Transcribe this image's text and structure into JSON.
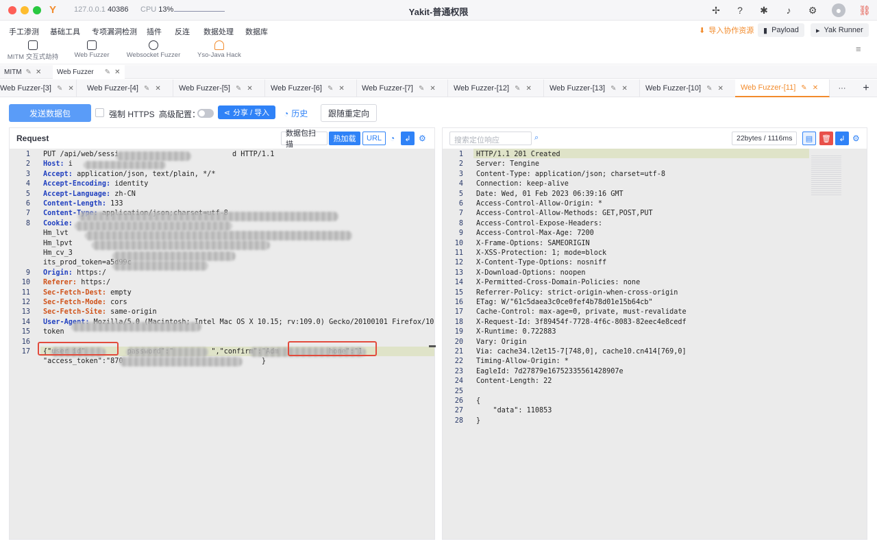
{
  "titlebar": {
    "engine_host": "127.0.0.1",
    "engine_port": "40386",
    "cpu_label": "CPU",
    "cpu_value": "13%",
    "title": "Yakit-普通权限"
  },
  "menu": {
    "items": [
      "手工渗测",
      "基础工具",
      "专项漏洞检测",
      "插件",
      "反连",
      "数据处理",
      "数据库"
    ],
    "quick": [
      "MITM 交互式劫持",
      "Web Fuzzer",
      "Websocket Fuzzer",
      "Yso-Java Hack"
    ],
    "import_label": "导入协作资源",
    "payload_label": "Payload",
    "runner_label": "Yak Runner"
  },
  "page_tabs": [
    {
      "label": "MITM"
    },
    {
      "label": "Web Fuzzer"
    }
  ],
  "fuzzer_tabs": [
    "Web Fuzzer-[3]",
    "Web Fuzzer-[4]",
    "Web Fuzzer-[5]",
    "Web Fuzzer-[6]",
    "Web Fuzzer-[7]",
    "Web Fuzzer-[12]",
    "Web Fuzzer-[13]",
    "Web Fuzzer-[10]",
    "Web Fuzzer-[11]"
  ],
  "fuzzer_more": "···",
  "toolbar": {
    "send": "发送数据包",
    "force_https": "强制 HTTPS",
    "advanced": "高级配置：",
    "share": "分享 / 导入",
    "history": "历史",
    "redirect": "跟随重定向"
  },
  "request": {
    "title": "Request",
    "btn_scan": "数据包扫描",
    "btn_hot": "热加载",
    "btn_url": "URL",
    "lines": [
      {
        "n": "1",
        "key": "",
        "val": "PUT /api/web/sessi                           d HTTP/1.1"
      },
      {
        "n": "2",
        "key": "Host:",
        "val": " i"
      },
      {
        "n": "3",
        "key": "Accept:",
        "val": " application/json, text/plain, */*"
      },
      {
        "n": "4",
        "key": "Accept-Encoding:",
        "val": " identity"
      },
      {
        "n": "5",
        "key": "Accept-Language:",
        "val": " zh-CN"
      },
      {
        "n": "6",
        "key": "Content-Length:",
        "val": " 133"
      },
      {
        "n": "7",
        "key": "Content-Type:",
        "val": " application/json;charset=utf-8"
      },
      {
        "n": "8",
        "key": "Cookie:",
        "val": ""
      },
      {
        "n": "",
        "key": "",
        "val": "Hm_lvt"
      },
      {
        "n": "",
        "key": "",
        "val": "Hm_lpvt"
      },
      {
        "n": "",
        "key": "",
        "val": "Hm_cv_3"
      },
      {
        "n": "",
        "key": "",
        "val": "its_prod_token=a5d99c"
      },
      {
        "n": "9",
        "key": "Origin:",
        "val": " https:/"
      },
      {
        "n": "10",
        "key": "Referer:",
        "val": " https:/"
      },
      {
        "n": "11",
        "key": "Sec-Fetch-Dest:",
        "val": " empty"
      },
      {
        "n": "12",
        "key": "Sec-Fetch-Mode:",
        "val": " cors"
      },
      {
        "n": "13",
        "key": "Sec-Fetch-Site:",
        "val": " same-origin"
      },
      {
        "n": "14",
        "key": "User-Agent:",
        "val": " Mozilla/5.0 (Macintosh; Intel Mac OS X 10.15; rv:109.0) Gecko/20100101 Firefox/109.0"
      },
      {
        "n": "15",
        "key": "",
        "val": "token"
      },
      {
        "n": "16",
        "key": "",
        "val": ""
      },
      {
        "n": "17",
        "key": "",
        "val": "{\"user_id\"          password\":\"         \",\"confirm\":\"Adm            hone\":\"1"
      },
      {
        "n": "",
        "key": "",
        "val": "\"access_token\":\"870                                 }"
      }
    ]
  },
  "response": {
    "search_placeholder": "搜索定位响应",
    "bytes": "22bytes / 1116ms",
    "lines": [
      {
        "n": "1",
        "val": "HTTP/1.1 201 Created"
      },
      {
        "n": "2",
        "val": "Server: Tengine"
      },
      {
        "n": "3",
        "val": "Content-Type: application/json; charset=utf-8"
      },
      {
        "n": "4",
        "val": "Connection: keep-alive"
      },
      {
        "n": "5",
        "val": "Date: Wed, 01 Feb 2023 06:39:16 GMT"
      },
      {
        "n": "6",
        "val": "Access-Control-Allow-Origin: *"
      },
      {
        "n": "7",
        "val": "Access-Control-Allow-Methods: GET,POST,PUT"
      },
      {
        "n": "8",
        "val": "Access-Control-Expose-Headers:"
      },
      {
        "n": "9",
        "val": "Access-Control-Max-Age: 7200"
      },
      {
        "n": "10",
        "val": "X-Frame-Options: SAMEORIGIN"
      },
      {
        "n": "11",
        "val": "X-XSS-Protection: 1; mode=block"
      },
      {
        "n": "12",
        "val": "X-Content-Type-Options: nosniff"
      },
      {
        "n": "13",
        "val": "X-Download-Options: noopen"
      },
      {
        "n": "14",
        "val": "X-Permitted-Cross-Domain-Policies: none"
      },
      {
        "n": "15",
        "val": "Referrer-Policy: strict-origin-when-cross-origin"
      },
      {
        "n": "16",
        "val": "ETag: W/\"61c5daea3c0ce0fef4b78d01e15b64cb\""
      },
      {
        "n": "17",
        "val": "Cache-Control: max-age=0, private, must-revalidate"
      },
      {
        "n": "18",
        "val": "X-Request-Id: 3f89454f-7728-4f6c-8083-82eec4e8cedf"
      },
      {
        "n": "19",
        "val": "X-Runtime: 0.722883"
      },
      {
        "n": "20",
        "val": "Vary: Origin"
      },
      {
        "n": "21",
        "val": "Via: cache34.l2et15-7[748,0], cache10.cn414[769,0]"
      },
      {
        "n": "22",
        "val": "Timing-Allow-Origin: *"
      },
      {
        "n": "23",
        "val": "EagleId: 7d27879e16752335561428907e"
      },
      {
        "n": "24",
        "val": "Content-Length: 22"
      },
      {
        "n": "25",
        "val": ""
      },
      {
        "n": "26",
        "val": "{"
      },
      {
        "n": "27",
        "val": "    \"data\": 110853"
      },
      {
        "n": "28",
        "val": "}"
      }
    ]
  },
  "colors": {
    "accent": "#f28b2c",
    "primary": "#2f82f7",
    "danger": "#e8504a"
  }
}
